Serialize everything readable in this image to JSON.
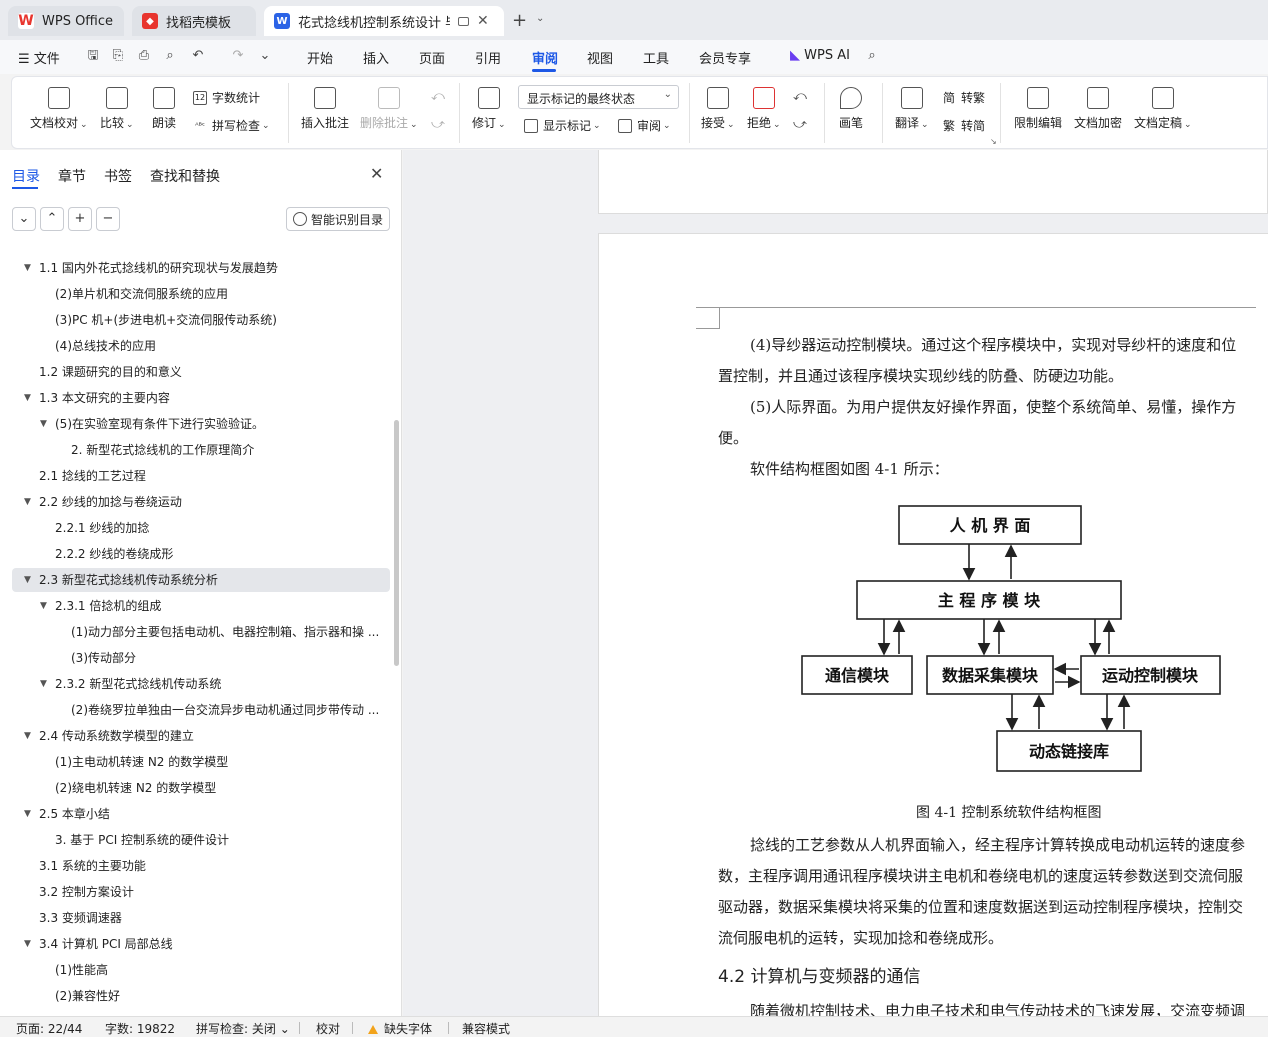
{
  "tabs": [
    {
      "label": "WPS Office",
      "icon": "wps-logo-icon",
      "color": "#e8352e"
    },
    {
      "label": "找稻壳模板",
      "icon": "docer-icon",
      "color": "#e8352e"
    },
    {
      "label": "花式捻线机控制系统设计 毕业",
      "icon": "writer-icon",
      "color": "#2b63e6"
    }
  ],
  "menu": {
    "file_label": "文件",
    "items": [
      "开始",
      "插入",
      "页面",
      "引用",
      "审阅",
      "视图",
      "工具",
      "会员专享"
    ],
    "active": "审阅",
    "ai_label": "WPS AI"
  },
  "ribbon": {
    "doc_check": "文档校对",
    "compare": "比较",
    "read_aloud": "朗读",
    "word_count": "字数统计",
    "spell_check": "拼写检查",
    "insert_comment": "插入批注",
    "delete_comment": "删除批注",
    "track_changes": "修订",
    "markup_state": "显示标记的最终状态",
    "show_markup": "显示标记",
    "review": "审阅",
    "accept": "接受",
    "reject": "拒绝",
    "pen": "画笔",
    "translate": "翻译",
    "to_traditional": "转繁",
    "to_simplified": "转简",
    "restrict_edit": "限制编辑",
    "encrypt": "文档加密",
    "finalize": "文档定稿"
  },
  "panel": {
    "tabs": [
      "目录",
      "章节",
      "书签",
      "查找和替换"
    ],
    "smart_toc": "智能识别目录",
    "toc": [
      {
        "text": "1.1 国内外花式捻线机的研究现状与发展趋势",
        "level": 0,
        "arrow": true
      },
      {
        "text": "(2)单片机和交流伺服系统的应用",
        "level": 1,
        "arrow": false
      },
      {
        "text": "(3)PC 机+(步进电机+交流伺服传动系统)",
        "level": 1,
        "arrow": false
      },
      {
        "text": "(4)总线技术的应用",
        "level": 1,
        "arrow": false
      },
      {
        "text": "1.2 课题研究的目的和意义",
        "level": 0,
        "arrow": false
      },
      {
        "text": "1.3 本文研究的主要内容",
        "level": 0,
        "arrow": true
      },
      {
        "text": "(5)在实验室现有条件下进行实验验证。",
        "level": 1,
        "arrow": true
      },
      {
        "text": "2. 新型花式捻线机的工作原理简介",
        "level": 2,
        "arrow": false
      },
      {
        "text": "2.1 捻线的工艺过程",
        "level": 0,
        "arrow": false
      },
      {
        "text": "2.2 纱线的加捻与卷绕运动",
        "level": 0,
        "arrow": true
      },
      {
        "text": "2.2.1 纱线的加捻",
        "level": 1,
        "arrow": false
      },
      {
        "text": "2.2.2 纱线的卷绕成形",
        "level": 1,
        "arrow": false
      },
      {
        "text": "2.3 新型花式捻线机传动系统分析",
        "level": 0,
        "arrow": true,
        "selected": true
      },
      {
        "text": "2.3.1 倍捻机的组成",
        "level": 1,
        "arrow": true
      },
      {
        "text": "(1)动力部分主要包括电动机、电器控制箱、指示器和操 ...",
        "level": 2,
        "arrow": false
      },
      {
        "text": "(3)传动部分",
        "level": 2,
        "arrow": false
      },
      {
        "text": "2.3.2 新型花式捻线机传动系统",
        "level": 1,
        "arrow": true
      },
      {
        "text": "(2)卷绕罗拉单独由一台交流异步电动机通过同步带传动 ...",
        "level": 2,
        "arrow": false
      },
      {
        "text": "2.4 传动系统数学模型的建立",
        "level": 0,
        "arrow": true
      },
      {
        "text": "(1)主电动机转速 N2 的数学模型",
        "level": 1,
        "arrow": false
      },
      {
        "text": "(2)绕电机转速 N2 的数学模型",
        "level": 1,
        "arrow": false
      },
      {
        "text": "2.5 本章小结",
        "level": 0,
        "arrow": true
      },
      {
        "text": "3. 基于 PCI 控制系统的硬件设计",
        "level": 1,
        "arrow": false
      },
      {
        "text": "3.1 系统的主要功能",
        "level": 0,
        "arrow": false
      },
      {
        "text": "3.2 控制方案设计",
        "level": 0,
        "arrow": false
      },
      {
        "text": "3.3 变频调速器",
        "level": 0,
        "arrow": false
      },
      {
        "text": "3.4 计算机 PCI 局部总线",
        "level": 0,
        "arrow": true
      },
      {
        "text": "(1)性能高",
        "level": 1,
        "arrow": false
      },
      {
        "text": "(2)兼容性好",
        "level": 1,
        "arrow": false
      }
    ]
  },
  "document": {
    "lines": [
      "(4)导纱器运动控制模块。通过这个程序模块中，实现对导纱杆的速度和位",
      "置控制，并且通过该程序模块实现纱线的防叠、防硬边功能。",
      "(5)人际界面。为用户提供友好操作界面，使整个系统简单、易懂，操作方",
      "便。",
      "软件结构框图如图 4-1 所示："
    ],
    "diagram": {
      "hmi": "人 机 界 面",
      "main": "主  程  序  模  块",
      "comm": "通信模块",
      "data": "数据采集模块",
      "motion": "运动控制模块",
      "dll": "动态链接库"
    },
    "caption": "图 4-1 控制系统软件结构框图",
    "para2": [
      "捻线的工艺参数从人机界面输入，经主程序计算转换成电动机运转的速度参",
      "数，主程序调用通讯程序模块讲主电机和卷绕电机的速度运转参数送到交流伺服",
      "驱动器，数据采集模块将采集的位置和速度数据送到运动控制程序模块，控制交",
      "流伺服电机的运转，实现加捻和卷绕成形。"
    ],
    "heading": "4.2 计算机与变频器的通信",
    "para3": "随着微机控制技术、电力电子技术和电气传动技术的飞速发展，交流变频调"
  },
  "status": {
    "page": "页面: 22/44",
    "words": "字数: 19822",
    "spell": "拼写检查: 关闭",
    "proof": "校对",
    "missing_font": "缺失字体",
    "compat": "兼容模式"
  }
}
